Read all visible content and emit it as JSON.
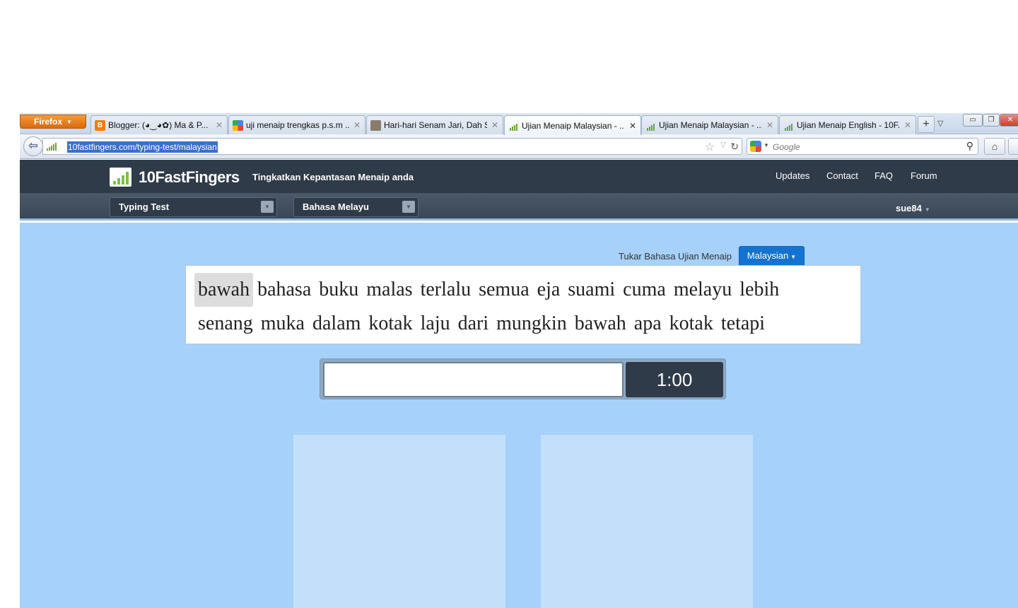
{
  "browser": {
    "firefox_button": "Firefox",
    "tabs": [
      {
        "title": "Blogger: (◕‿◕✿) Ma & P...",
        "favicon": "blogger-icon"
      },
      {
        "title": "uji menaip trengkas p.s.m ...",
        "favicon": "google-icon"
      },
      {
        "title": "Hari-hari Senam Jari, Dah S...",
        "favicon": "photo-icon"
      },
      {
        "title": "Ujian Menaip Malaysian - ...",
        "favicon": "signal-bars-icon",
        "active": true
      },
      {
        "title": "Ujian Menaip Malaysian - ...",
        "favicon": "signal-bars-icon"
      },
      {
        "title": "Ujian Menaip English - 10F...",
        "favicon": "signal-bars-icon"
      }
    ],
    "url": "10fastfingers.com/typing-test/malaysian",
    "search_placeholder": "Google"
  },
  "site": {
    "logo": "10FastFingers",
    "tagline": "Tingkatkan Kepantasan Menaip anda",
    "nav": [
      "Updates",
      "Contact",
      "FAQ",
      "Forum"
    ],
    "mode_select": "Typing Test",
    "language_select": "Bahasa Melayu",
    "username": "sue84"
  },
  "test": {
    "change_language_label": "Tukar Bahasa Ujian Menaip",
    "language_button": "Malaysian",
    "words_line1": [
      "bawah",
      "bahasa",
      "buku",
      "malas",
      "terlalu",
      "semua",
      "eja",
      "suami",
      "cuma",
      "melayu",
      "lebih"
    ],
    "words_line2": [
      "senang",
      "muka",
      "dalam",
      "kotak",
      "laju",
      "dari",
      "mungkin",
      "bawah",
      "apa",
      "kotak",
      "tetapi"
    ],
    "current_word_index": 0,
    "input_value": "",
    "timer": "1:00"
  },
  "colors": {
    "header_bg": "#2f3b48",
    "page_bg": "#a6d1fa",
    "accent_blue": "#1473d0",
    "logo_green": "#7cc243"
  }
}
